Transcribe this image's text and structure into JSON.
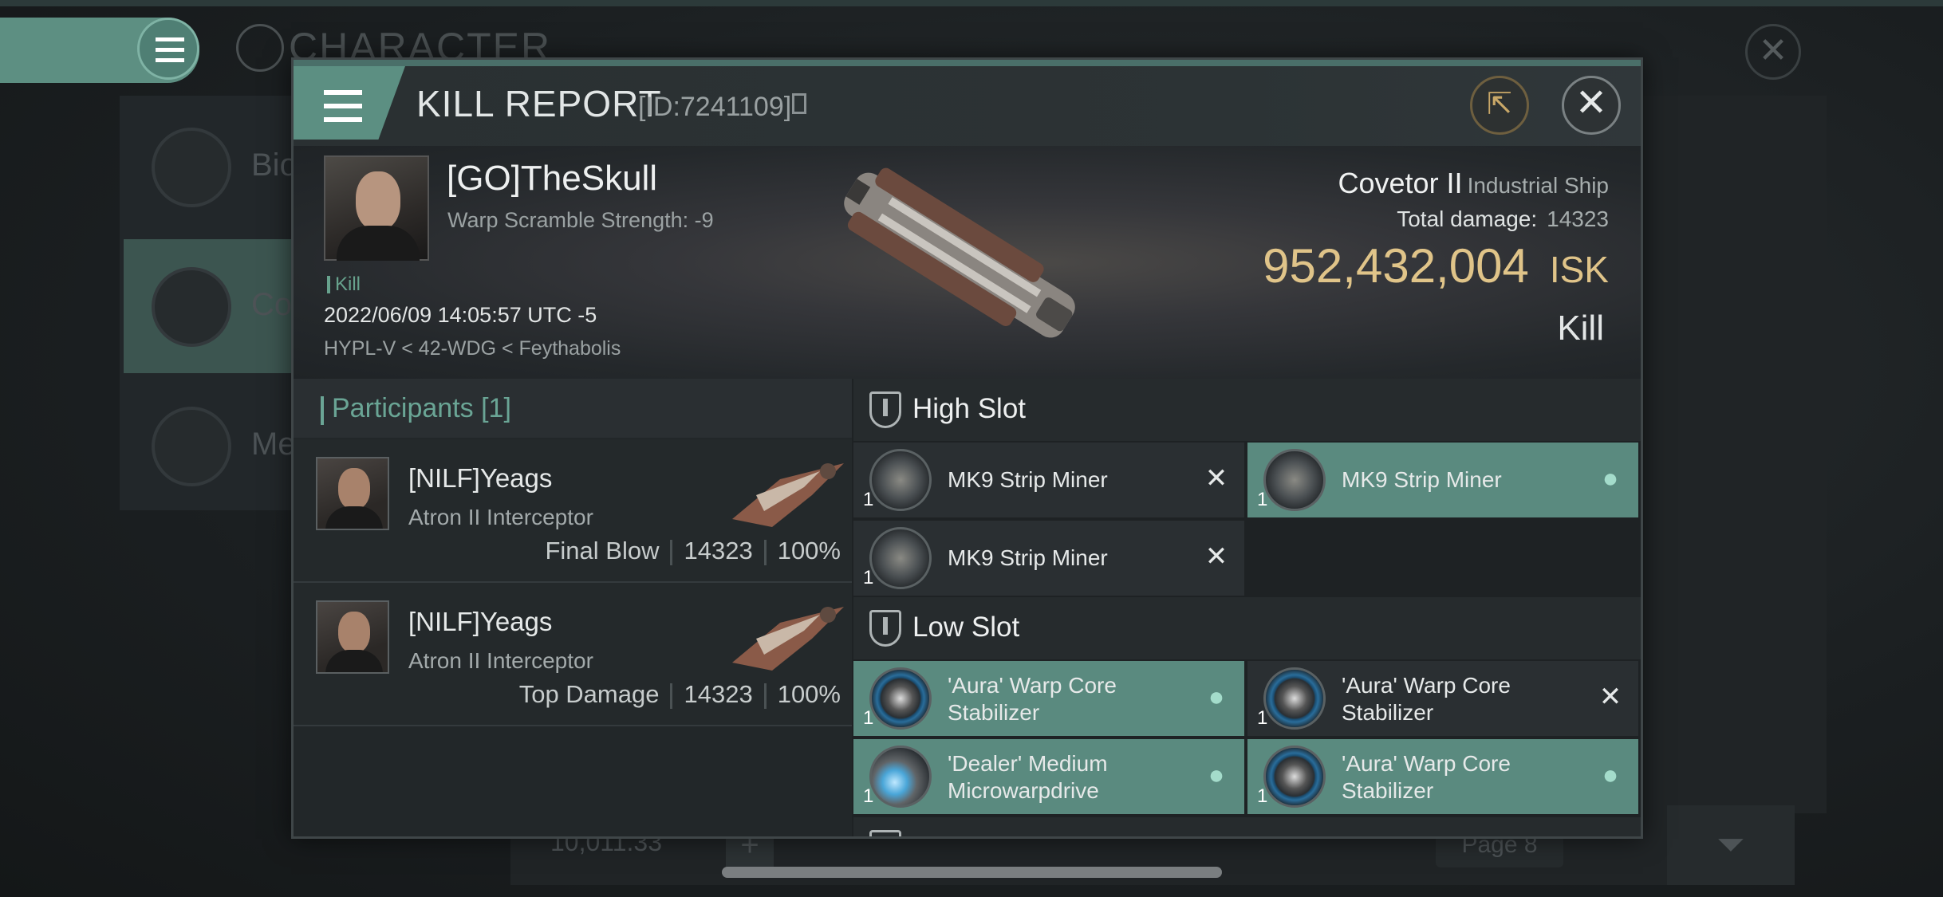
{
  "background": {
    "title": "CHARACTER",
    "sidebar_items": [
      "Bio",
      "Co",
      "Me"
    ],
    "isk_balance": "10,011.33",
    "page": "Page 8"
  },
  "header": {
    "title": "KILL REPORT",
    "id": "[ID:7241109]"
  },
  "victim": {
    "name": "[GO]TheSkull",
    "warp_scramble": "Warp Scramble Strength: -9",
    "kind": "Kill",
    "datetime": "2022/06/09 14:05:57 UTC -5",
    "location": "HYPL-V < 42-WDG < Feythabolis",
    "ship_name": "Covetor II",
    "ship_class": "Industrial Ship",
    "total_damage_label": "Total damage:",
    "total_damage": "14323",
    "isk_value": "952,432,004",
    "isk_unit": "ISK",
    "result": "Kill"
  },
  "participants": {
    "title": "Participants [1]",
    "items": [
      {
        "name": "[NILF]Yeags",
        "ship": "Atron II Interceptor",
        "role": "Final Blow",
        "damage": "14323",
        "percent": "100%"
      },
      {
        "name": "[NILF]Yeags",
        "ship": "Atron II Interceptor",
        "role": "Top Damage",
        "damage": "14323",
        "percent": "100%"
      }
    ]
  },
  "slots": {
    "high": {
      "title": "High Slot",
      "modules": [
        {
          "name": "MK9 Strip Miner",
          "qty": "1",
          "status": "destroyed"
        },
        {
          "name": "MK9 Strip Miner",
          "qty": "1",
          "status": "dropped"
        },
        {
          "name": "MK9 Strip Miner",
          "qty": "1",
          "status": "destroyed"
        }
      ]
    },
    "low": {
      "title": "Low Slot",
      "modules": [
        {
          "name": "'Aura' Warp Core Stabilizer",
          "qty": "1",
          "status": "dropped"
        },
        {
          "name": "'Aura' Warp Core Stabilizer",
          "qty": "1",
          "status": "destroyed"
        },
        {
          "name": "'Dealer' Medium Microwarpdrive",
          "qty": "1",
          "status": "dropped"
        },
        {
          "name": "'Aura' Warp Core Stabilizer",
          "qty": "1",
          "status": "dropped"
        }
      ]
    }
  },
  "colors": {
    "accent": "#5c8f82",
    "isk": "#e0c489",
    "dropped_bg": "#5a8a7f"
  }
}
